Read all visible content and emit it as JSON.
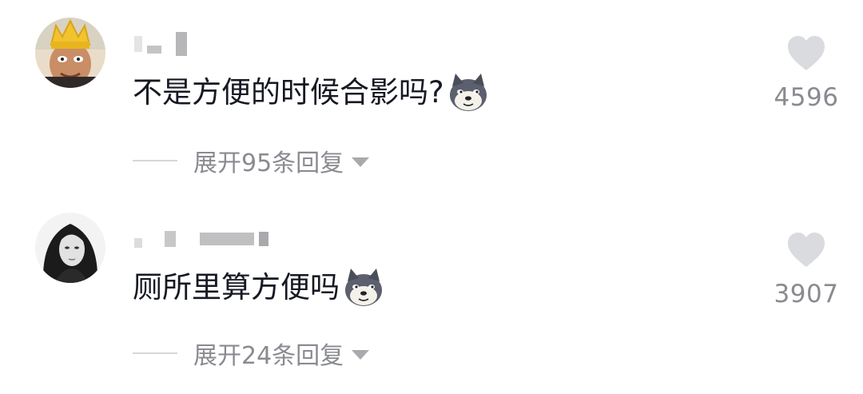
{
  "comments": [
    {
      "text": "不是方便的时候合影吗?",
      "emoji": "dog-face-emoji",
      "replies_label": "展开95条回复",
      "likes": "4596",
      "avatar": "cartoon-crown-avatar"
    },
    {
      "text": "厕所里算方便吗",
      "emoji": "dog-face-emoji",
      "replies_label": "展开24条回复",
      "likes": "3907",
      "avatar": "portrait-bw-avatar"
    }
  ],
  "colors": {
    "text": "#161823",
    "muted": "#8a8b91",
    "heart": "#dadbde",
    "divider": "#d6d7da"
  }
}
